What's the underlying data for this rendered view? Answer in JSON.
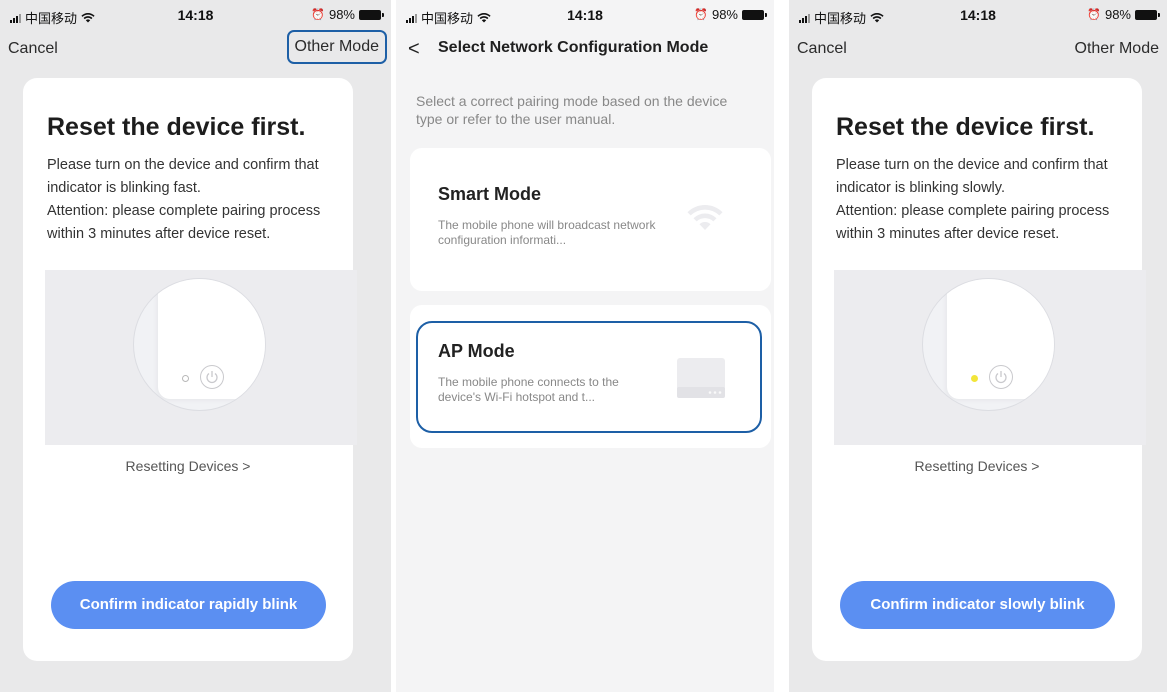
{
  "screens": [
    {
      "status": {
        "carrier": "中国移动",
        "time": "14:18",
        "battery": "98%"
      },
      "nav": {
        "left": "Cancel",
        "right": "Other Mode"
      },
      "title": "Reset the device first.",
      "desc": [
        "Please turn on the device and confirm that",
        "indicator is blinking fast.",
        "Attention: please complete pairing process",
        "within 3 minutes after device reset."
      ],
      "reset_link": "Resetting Devices >",
      "confirm": "Confirm indicator rapidly blink",
      "indicator_lit": false
    },
    {
      "status": {
        "carrier": "中国移动",
        "time": "14:18",
        "battery": "98%"
      },
      "nav": {
        "back": "<",
        "title": "Select Network Configuration Mode"
      },
      "hint": "Select a correct pairing mode based on the device type or refer to the user manual.",
      "modes": [
        {
          "title": "Smart Mode",
          "desc": "The mobile phone will broadcast network configuration informati...",
          "icon": "wifi-icon"
        },
        {
          "title": "AP Mode",
          "desc": "The mobile phone connects to the device's Wi-Fi hotspot and t...",
          "icon": "router-icon"
        }
      ]
    },
    {
      "status": {
        "carrier": "中国移动",
        "time": "14:18",
        "battery": "98%"
      },
      "nav": {
        "left": "Cancel",
        "right": "Other Mode"
      },
      "title": "Reset the device first.",
      "desc": [
        "Please turn on the device and confirm that",
        "indicator is blinking slowly.",
        "Attention: please complete pairing process",
        "within 3 minutes after device reset."
      ],
      "reset_link": "Resetting Devices >",
      "confirm": "Confirm indicator slowly blink",
      "indicator_lit": true
    }
  ],
  "colors": {
    "accent": "#5b8ff2",
    "highlight_border": "#1d5fa6",
    "indicator_yellow": "#f2e53a"
  }
}
